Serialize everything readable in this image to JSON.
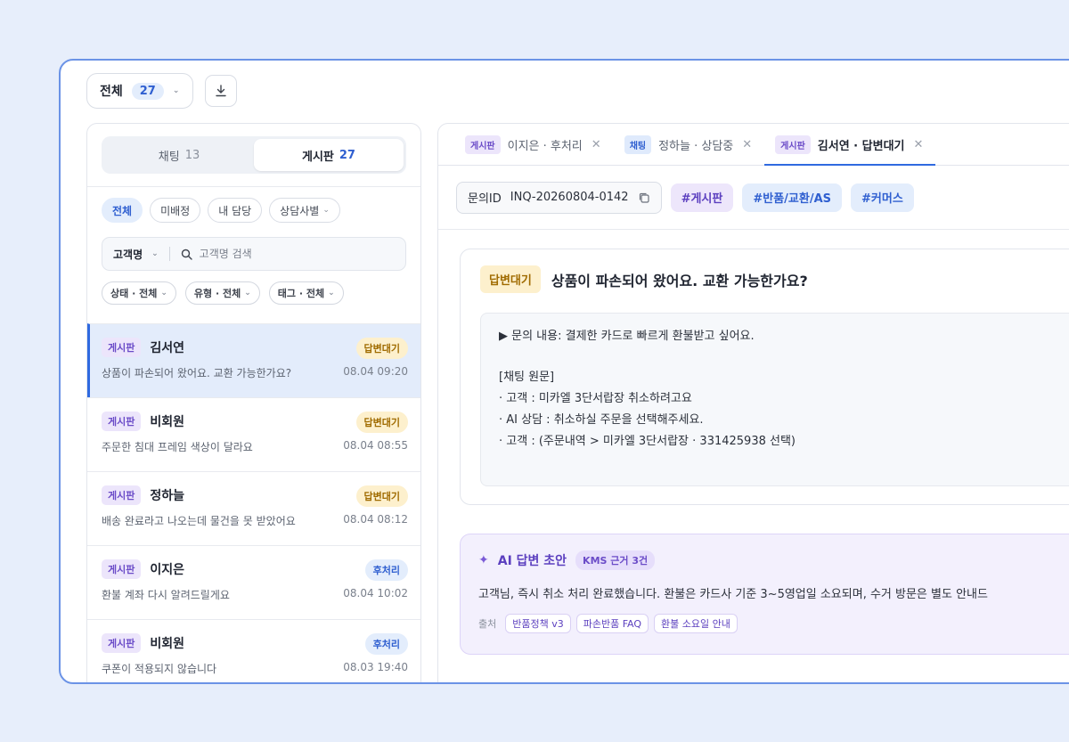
{
  "topbar": {
    "filter_label": "전체",
    "filter_count": "27"
  },
  "left": {
    "segments": [
      {
        "label": "채팅",
        "count": "13"
      },
      {
        "label": "게시판",
        "count": "27"
      }
    ],
    "chips": [
      "전체",
      "미배정",
      "내 담당",
      "상담사별"
    ],
    "search": {
      "select_label": "고객명",
      "placeholder": "고객명 검색"
    },
    "filters": [
      "상태 · 전체",
      "유형 · 전체",
      "태그 · 전체"
    ],
    "rows": [
      {
        "tag": "게시판",
        "name": "김서연",
        "status": "답변대기",
        "preview": "상품이 파손되어 왔어요. 교환 가능한가요?",
        "time": "08.04 09:20"
      },
      {
        "tag": "게시판",
        "name": "비회원",
        "status": "답변대기",
        "preview": "주문한 침대 프레임 색상이 달라요",
        "time": "08.04 08:55"
      },
      {
        "tag": "게시판",
        "name": "정하늘",
        "status": "답변대기",
        "preview": "배송 완료라고 나오는데 물건을 못 받았어요",
        "time": "08.04 08:12"
      },
      {
        "tag": "게시판",
        "name": "이지은",
        "status": "후처리",
        "preview": "환불 계좌 다시 알려드릴게요",
        "time": "08.04 10:02"
      },
      {
        "tag": "게시판",
        "name": "비회원",
        "status": "후처리",
        "preview": "쿠폰이 적용되지 않습니다",
        "time": "08.03 19:40"
      }
    ]
  },
  "tabs": [
    {
      "type": "게시판",
      "label": "이지은 · 후처리"
    },
    {
      "type": "채팅",
      "label": "정하늘 · 상담중"
    },
    {
      "type": "게시판",
      "label": "김서연 · 답변대기"
    }
  ],
  "detail": {
    "id_label": "문의ID",
    "id_value": "INQ-20260804-0142",
    "hashtags": [
      "#게시판",
      "#반품/교환/AS",
      "#커머스"
    ],
    "status": "답변대기",
    "title": "상품이 파손되어 왔어요. 교환 가능한가요?",
    "body": {
      "inquiry": "▶ 문의 내용: 결제한 카드로 빠르게 환불받고 싶어요.",
      "chat_header": "[채팅 원문]",
      "lines": [
        "· 고객   : 미카엘 3단서랍장 취소하려고요",
        "· AI 상담 : 취소하실 주문을 선택해주세요.",
        "· 고객   : (주문내역 > 미카엘 3단서랍장 · 331425938 선택)"
      ]
    }
  },
  "ai": {
    "title": "AI 답변 초안",
    "kms": "KMS 근거 3건",
    "text": "고객님, 즉시 취소 처리 완료했습니다. 환불은 카드사 기준 3~5영업일 소요되며, 수거 방문은 별도 안내드",
    "source_label": "출처",
    "sources": [
      "반품정책 v3",
      "파손반품 FAQ",
      "환불 소요일 안내"
    ]
  }
}
